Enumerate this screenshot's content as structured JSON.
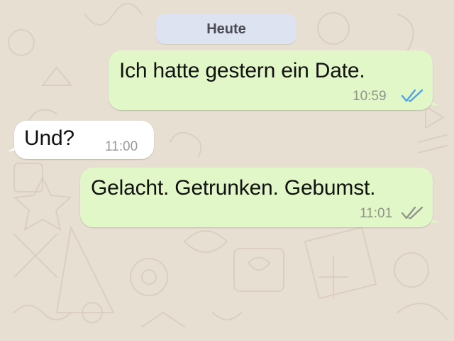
{
  "chat": {
    "date_separator": "Heute",
    "messages": [
      {
        "direction": "outgoing",
        "text": "Ich hatte gestern ein Date.",
        "time": "10:59",
        "status_icon": "double-check-read-icon"
      },
      {
        "direction": "incoming",
        "text": "Und?",
        "time": "11:00"
      },
      {
        "direction": "outgoing",
        "text": "Gelacht. Getrunken. Gebumst.",
        "time": "11:01",
        "status_icon": "double-check-delivered-icon"
      }
    ]
  },
  "colors": {
    "wallpaper": "#e8dfd3",
    "outgoing_bubble": "#e1f7c8",
    "incoming_bubble": "#ffffff",
    "date_pill": "#dde3f0",
    "read_ticks": "#4fa0e4",
    "delivered_ticks": "#8e9487"
  }
}
